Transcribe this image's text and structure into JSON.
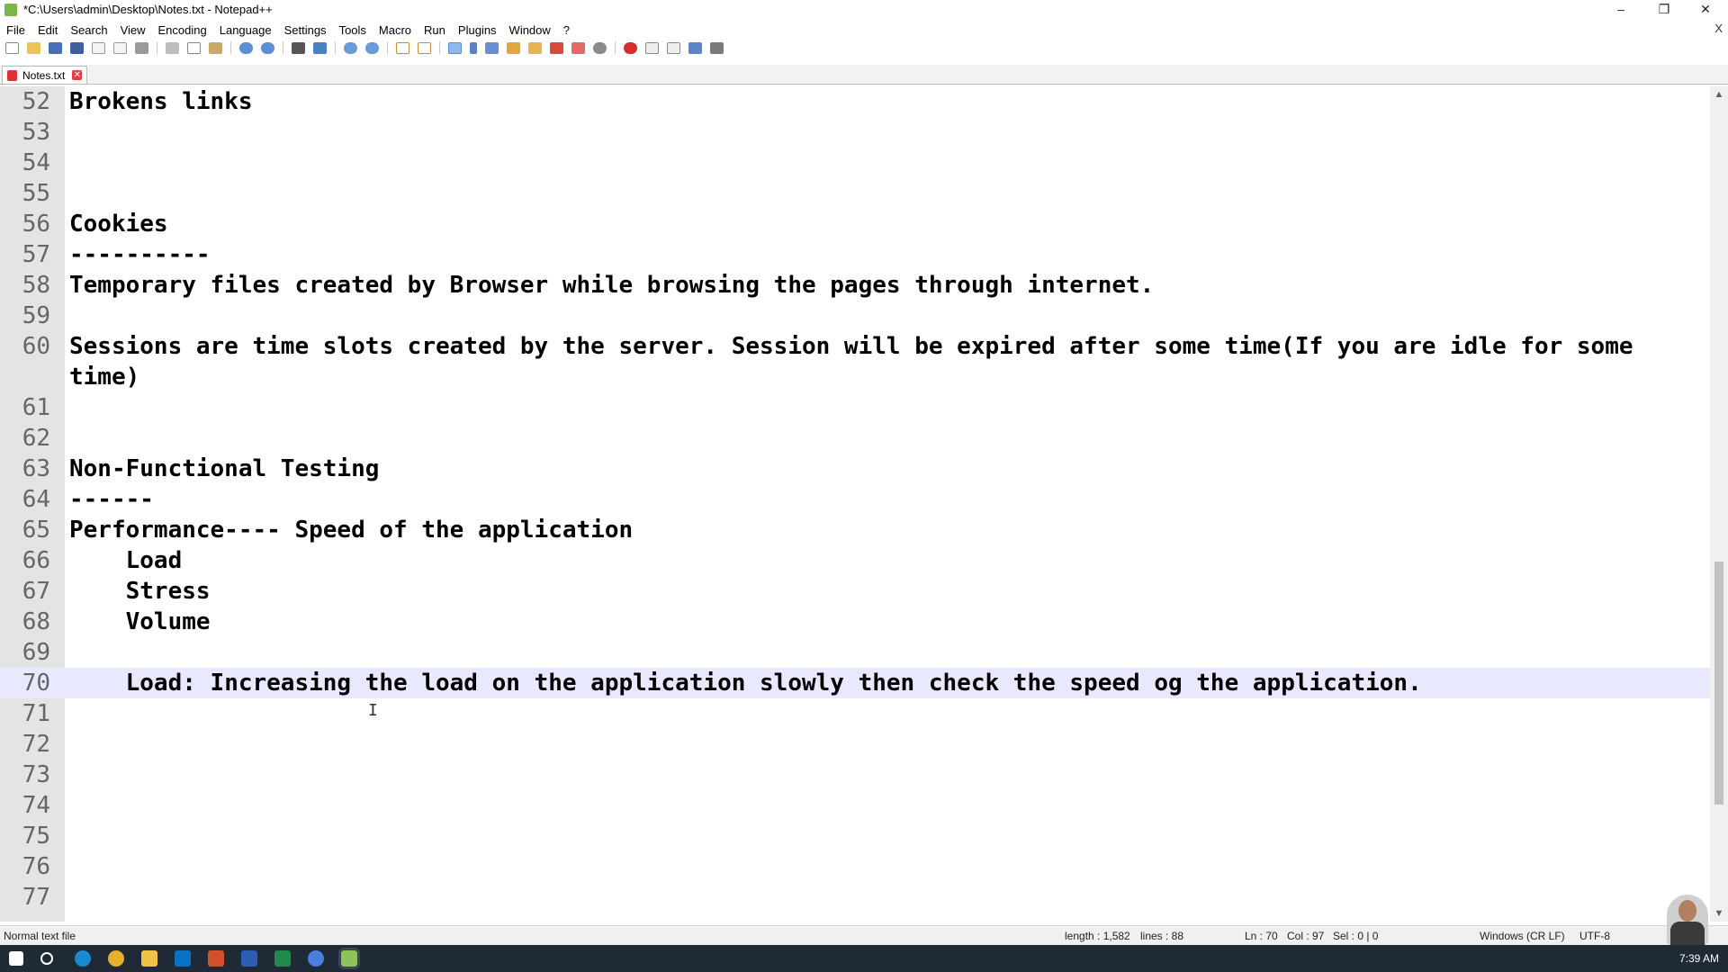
{
  "window": {
    "title": "*C:\\Users\\admin\\Desktop\\Notes.txt - Notepad++",
    "minimize_glyph": "–",
    "restore_glyph": "❐",
    "close_glyph": "✕"
  },
  "menu": {
    "items": [
      "File",
      "Edit",
      "Search",
      "View",
      "Encoding",
      "Language",
      "Settings",
      "Tools",
      "Macro",
      "Run",
      "Plugins",
      "Window",
      "?"
    ],
    "close_glyph": "X"
  },
  "toolbar": {
    "icons": [
      "new-file-icon",
      "open-file-icon",
      "save-icon",
      "save-all-icon",
      "close-icon",
      "close-all-icon",
      "print-icon",
      "cut-icon",
      "copy-icon",
      "paste-icon",
      "undo-icon",
      "redo-icon",
      "find-icon",
      "replace-icon",
      "zoom-in-icon",
      "zoom-out-icon",
      "sync-vertical-icon",
      "sync-horizontal-icon",
      "word-wrap-icon",
      "show-all-chars-icon",
      "indent-guide-icon",
      "document-map-icon",
      "function-list-icon",
      "folder-workspace-icon",
      "monitoring-icon",
      "record-macro-icon",
      "stop-macro-icon",
      "play-macro-icon",
      "run-macro-multiple-icon",
      "save-macro-icon"
    ]
  },
  "tab": {
    "label": "Notes.txt"
  },
  "editor": {
    "lines": [
      {
        "num": "52",
        "text": "Brokens links"
      },
      {
        "num": "53",
        "text": ""
      },
      {
        "num": "54",
        "text": ""
      },
      {
        "num": "55",
        "text": ""
      },
      {
        "num": "56",
        "text": "Cookies"
      },
      {
        "num": "57",
        "text": "----------"
      },
      {
        "num": "58",
        "text": "Temporary files created by Browser while browsing the pages through internet."
      },
      {
        "num": "59",
        "text": ""
      },
      {
        "num": "60",
        "text": "Sessions are time slots created by the server. Session will be expired after some time(If you are idle for some time)",
        "wrap": true
      },
      {
        "num": "61",
        "text": ""
      },
      {
        "num": "62",
        "text": ""
      },
      {
        "num": "63",
        "text": "Non-Functional Testing"
      },
      {
        "num": "64",
        "text": "------"
      },
      {
        "num": "65",
        "text": "Performance---- Speed of the application"
      },
      {
        "num": "66",
        "text": "    Load"
      },
      {
        "num": "67",
        "text": "    Stress"
      },
      {
        "num": "68",
        "text": "    Volume"
      },
      {
        "num": "69",
        "text": ""
      },
      {
        "num": "70",
        "text": "    Load: Increasing the load on the application slowly then check the speed og the application.",
        "current": true
      },
      {
        "num": "71",
        "text": ""
      },
      {
        "num": "72",
        "text": ""
      },
      {
        "num": "73",
        "text": ""
      },
      {
        "num": "74",
        "text": ""
      },
      {
        "num": "75",
        "text": ""
      },
      {
        "num": "76",
        "text": ""
      },
      {
        "num": "77",
        "text": ""
      }
    ],
    "current_line_color": "#e8e8ff",
    "gutter_color": "#e4e4e4"
  },
  "statusbar": {
    "file_type": "Normal text file",
    "length": "length : 1,582",
    "lines": "lines : 88",
    "position": "Ln : 70",
    "column": "Col : 97",
    "selection": "Sel : 0 | 0",
    "eol": "Windows (CR LF)",
    "encoding": "UTF-8"
  },
  "taskbar": {
    "icons": [
      "windows-start-icon",
      "search-icon",
      "edge-icon",
      "chrome-icon",
      "file-explorer-icon",
      "outlook-icon",
      "powerpoint-icon",
      "word-icon",
      "excel-icon",
      "chat-icon",
      "notepadpp-icon"
    ],
    "time": "7:39 AM"
  }
}
